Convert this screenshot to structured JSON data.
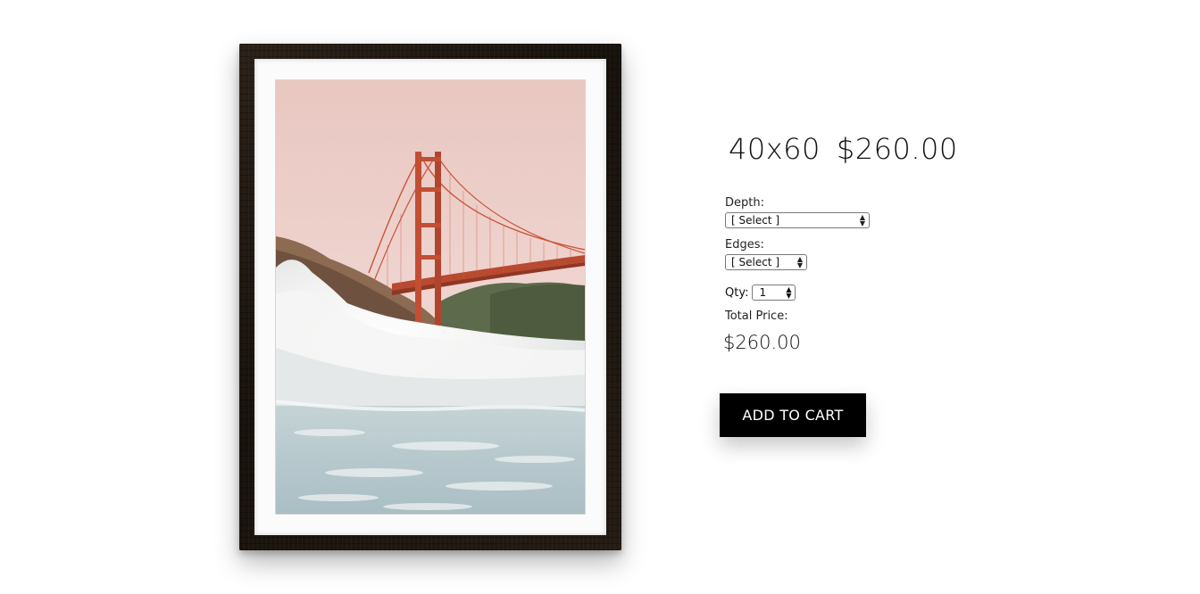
{
  "product": {
    "size": "40x60",
    "price": "$260.00",
    "image_name": "golden-gate-bridge-wave-photo"
  },
  "options": {
    "depth_label": "Depth:",
    "depth_value": "[ Select ]",
    "edges_label": "Edges:",
    "edges_value": "[ Select ]",
    "qty_label": "Qty:",
    "qty_value": "1"
  },
  "total": {
    "label": "Total Price:",
    "value": "$260.00"
  },
  "cart": {
    "button_label": "ADD TO CART"
  },
  "icons": {
    "select_arrow": "up-down-arrow-icon"
  },
  "colors": {
    "button_bg": "#000000",
    "button_text": "#ffffff",
    "frame": "#1c150f",
    "bridge": "#c9553a"
  }
}
